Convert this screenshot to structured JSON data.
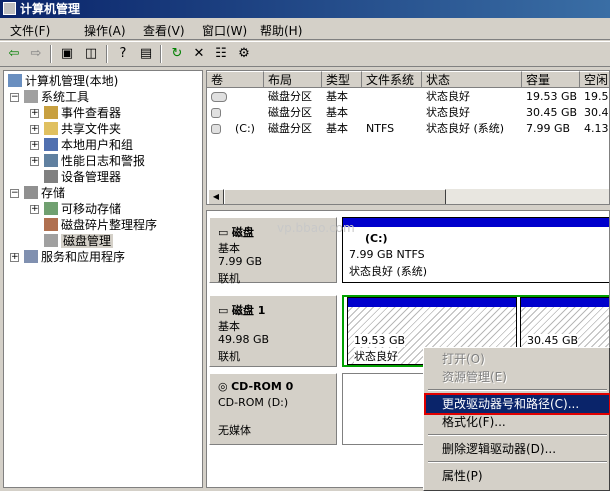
{
  "window": {
    "title": "计算机管理"
  },
  "menu": [
    "文件(F)",
    "操作(A)",
    "查看(V)",
    "窗口(W)",
    "帮助(H)"
  ],
  "tree": {
    "root": "计算机管理(本地)",
    "system_tools": "系统工具",
    "event_viewer": "事件查看器",
    "shared_folders": "共享文件夹",
    "local_users": "本地用户和组",
    "perf_logs": "性能日志和警报",
    "device_manager": "设备管理器",
    "storage": "存储",
    "removable_storage": "可移动存储",
    "defrag": "磁盘碎片整理程序",
    "disk_mgmt": "磁盘管理",
    "services_apps": "服务和应用程序"
  },
  "volume_list": {
    "columns": [
      "卷",
      "布局",
      "类型",
      "文件系统",
      "状态",
      "容量",
      "空闲"
    ],
    "rows": [
      [
        "",
        "磁盘分区",
        "基本",
        "",
        "状态良好",
        "19.53 GB",
        "19.5"
      ],
      [
        "",
        "磁盘分区",
        "基本",
        "",
        "状态良好",
        "30.45 GB",
        "30.4"
      ],
      [
        "(C:)",
        "磁盘分区",
        "基本",
        "NTFS",
        "状态良好 (系统)",
        "7.99 GB",
        "4.13"
      ]
    ]
  },
  "disks": {
    "disk0": {
      "name": "磁盘",
      "type": "基本",
      "size": "7.99 GB",
      "status": "联机",
      "part_label": "(C:)",
      "part_size": "7.99 GB NTFS",
      "part_status": "状态良好 (系统)"
    },
    "disk1": {
      "name": "磁盘 1",
      "type": "基本",
      "size": "49.98 GB",
      "status": "联机",
      "p1_size": "19.53 GB",
      "p1_status": "状态良好",
      "p2_size": "30.45 GB"
    },
    "cdrom": {
      "name": "CD-ROM 0",
      "type": "CD-ROM (D:)",
      "status": "无媒体"
    }
  },
  "watermark": "vp.bbao.com",
  "context_menu": {
    "open": "打开(O)",
    "explore": "资源管理(E)",
    "change_letter": "更改驱动器号和路径(C)...",
    "format": "格式化(F)...",
    "delete": "删除逻辑驱动器(D)...",
    "properties": "属性(P)"
  }
}
